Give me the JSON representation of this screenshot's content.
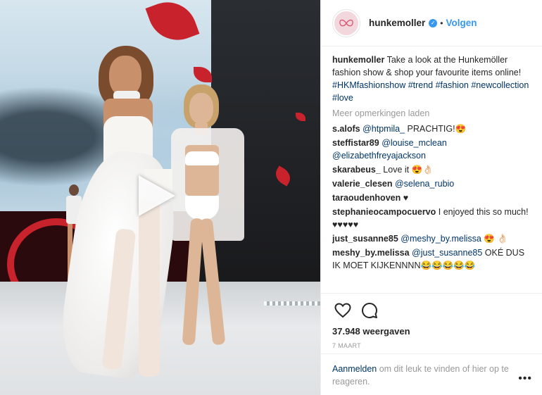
{
  "post": {
    "username": "hunkemoller",
    "follow_label": "Volgen",
    "separator": "•"
  },
  "caption": {
    "username": "hunkemoller",
    "text_before": " Take a look at the Hunkemöller fashion show & shop your favourite items online! ",
    "hashtags": "#HKMfashionshow #trend #fashion #newcollection #love"
  },
  "load_more": "Meer opmerkingen laden",
  "comments": [
    {
      "user": "s.alofs",
      "mention": "@htpmila_",
      "text": " PRACHTIG!😍"
    },
    {
      "user": "steffistar89",
      "mention": "@louise_mclean @elizabethfreyajackson",
      "text": ""
    },
    {
      "user": "skarabeus_",
      "mention": "",
      "text": "Love it 😍👌🏻"
    },
    {
      "user": "valerie_clesen",
      "mention": "@selena_rubio",
      "text": ""
    },
    {
      "user": "taraoudenhoven",
      "mention": "",
      "text": "♥"
    },
    {
      "user": "stephanieocampocuervo",
      "mention": "",
      "text": "I enjoyed this so much! ♥♥♥♥♥"
    },
    {
      "user": "just_susanne85",
      "mention": "@meshy_by.melissa",
      "text": " 😍 👌🏻"
    },
    {
      "user": "meshy_by.melissa",
      "mention": "@just_susanne85",
      "text": " OKÉ DUS IK MOET KIJKENNNN😂😂😂😂😂"
    }
  ],
  "stats": {
    "views": "37.948 weergaven",
    "date": "7 MAART"
  },
  "login": {
    "link": "Aanmelden",
    "text": " om dit leuk te vinden of hier op te reageren."
  },
  "more_options": "•••",
  "colors": {
    "accent": "#3897f0",
    "link": "#003569",
    "muted": "#999999",
    "brand_pink": "#f2d7dc",
    "stage_red": "#c8232c"
  },
  "icons": [
    "play-icon",
    "verified-badge-icon",
    "heart-icon",
    "comment-icon",
    "more-options-icon"
  ]
}
